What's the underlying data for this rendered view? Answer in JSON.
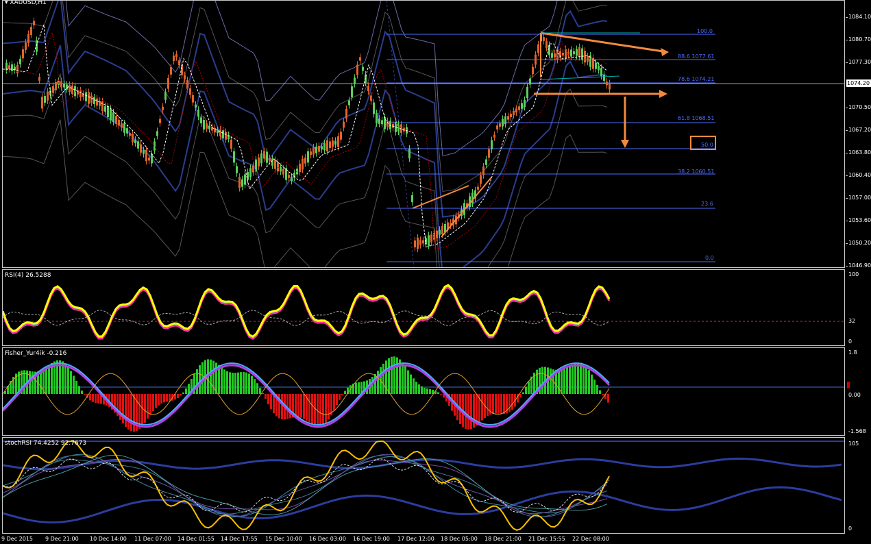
{
  "window": {
    "title": "XAUUSD,H1"
  },
  "main_chart": {
    "price_ticks": [
      "1084.10",
      "1080.70",
      "1077.30",
      "1074.20",
      "1070.50",
      "1067.20",
      "1063.80",
      "1060.40",
      "1057.00",
      "1053.60",
      "1050.20",
      "1046.90"
    ],
    "current_price": "1074.20",
    "fib_levels": [
      {
        "label": "100.0"
      },
      {
        "label": "88.6 1077.61"
      },
      {
        "label": "78.6 1074.21"
      },
      {
        "label": "61.8 1068.51"
      },
      {
        "label": "50.0"
      },
      {
        "label": "38.2 1060.51"
      },
      {
        "label": "23.6"
      },
      {
        "label": "0.0"
      }
    ],
    "highlight_color": "#f58a3c",
    "fib_color": "#4e6cff"
  },
  "rsi_panel": {
    "title": "RSI(4) 26.5288",
    "ticks": [
      "100",
      "32",
      "0"
    ]
  },
  "fisher_panel": {
    "title": "Fisher_Yur4ik -0.216",
    "ticks": [
      "1.8",
      "0.00",
      "-1.568"
    ]
  },
  "stoch_panel": {
    "title": "stochRSI 74.4252 92.7673",
    "ticks": [
      "105",
      "0"
    ]
  },
  "time_axis": [
    "9 Dec 2015",
    "9 Dec 21:00",
    "10 Dec 14:00",
    "11 Dec 07:00",
    "14 Dec 01:55",
    "14 Dec 17:55",
    "15 Dec 10:00",
    "16 Dec 03:00",
    "16 Dec 19:00",
    "17 Dec 12:00",
    "18 Dec 05:00",
    "18 Dec 21:00",
    "21 Dec 15:55",
    "22 Dec 08:00"
  ]
}
